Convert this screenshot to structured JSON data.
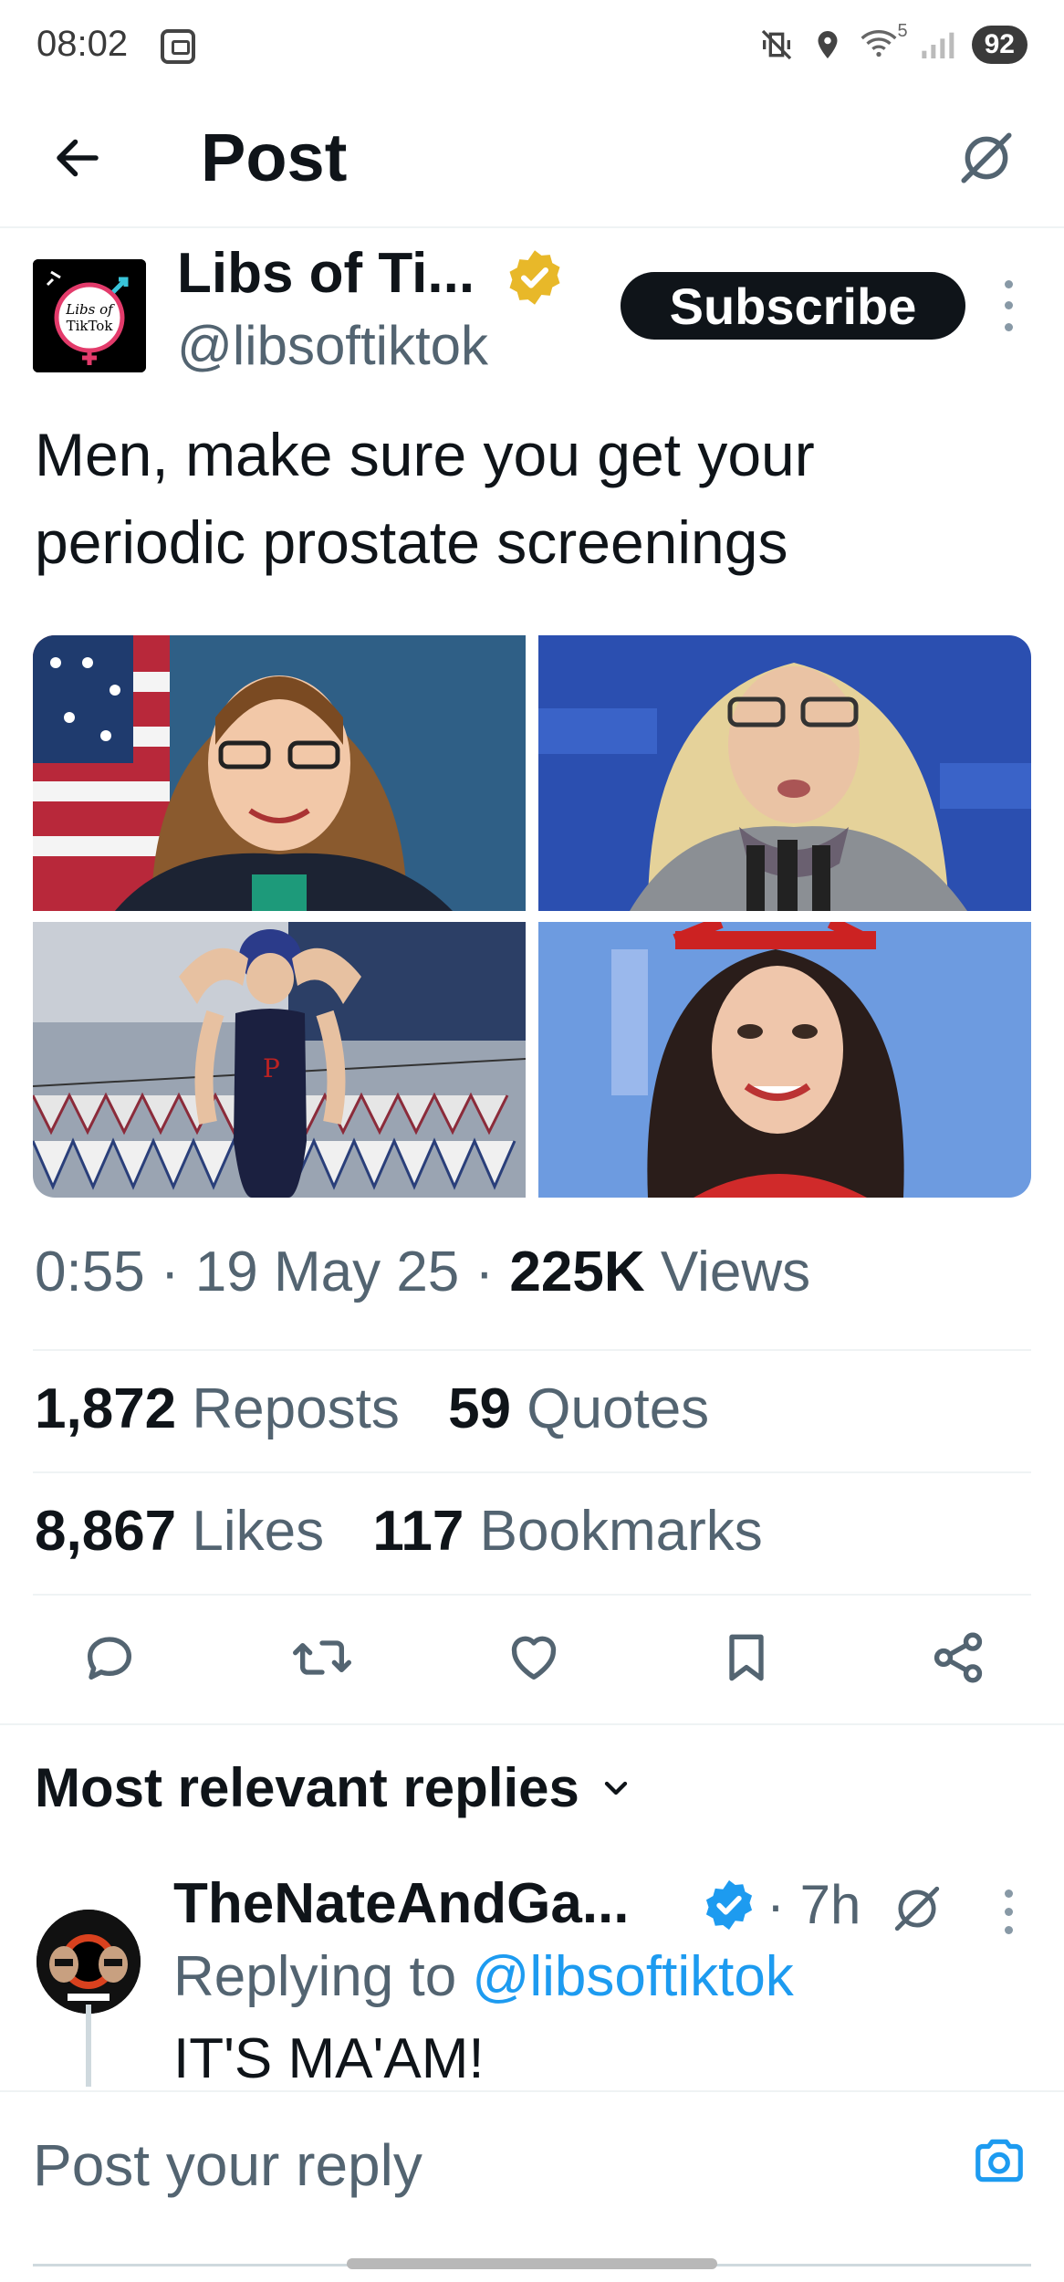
{
  "status_bar": {
    "time": "08:02",
    "signal_label": "5",
    "battery": "92"
  },
  "header": {
    "title": "Post"
  },
  "post": {
    "author": {
      "display_name": "Libs of Ti...",
      "handle": "@libsoftiktok",
      "avatar_text_line1": "Libs of",
      "avatar_text_line2": "TikTok"
    },
    "subscribe_label": "Subscribe",
    "text": "Men, make sure you get your periodic prostate screenings",
    "media_count": 4,
    "time": "0:55",
    "date": "19 May 25",
    "views_count": "225K",
    "views_label": "Views",
    "reposts_count": "1,872",
    "reposts_label": "Reposts",
    "quotes_count": "59",
    "quotes_label": "Quotes",
    "likes_count": "8,867",
    "likes_label": "Likes",
    "bookmarks_count": "117",
    "bookmarks_label": "Bookmarks"
  },
  "replies": {
    "heading": "Most relevant replies",
    "items": [
      {
        "display_name": "TheNateAndGa...",
        "time": "7h",
        "replying_prefix": "Replying to",
        "replying_handle": "@libsoftiktok",
        "text": "IT'S MA'AM!"
      }
    ]
  },
  "composer": {
    "placeholder": "Post your reply"
  },
  "colors": {
    "text_primary": "#0f1419",
    "text_secondary": "#536471",
    "link": "#1d9bf0",
    "verified_gold": "#e8b829",
    "verified_blue": "#1d9bf0"
  },
  "icons": {
    "back": "arrow-left-icon",
    "grok": "grok-icon",
    "reply": "reply-icon",
    "repost": "repost-icon",
    "like": "heart-icon",
    "bookmark": "bookmark-icon",
    "share": "share-icon",
    "camera": "camera-icon"
  }
}
